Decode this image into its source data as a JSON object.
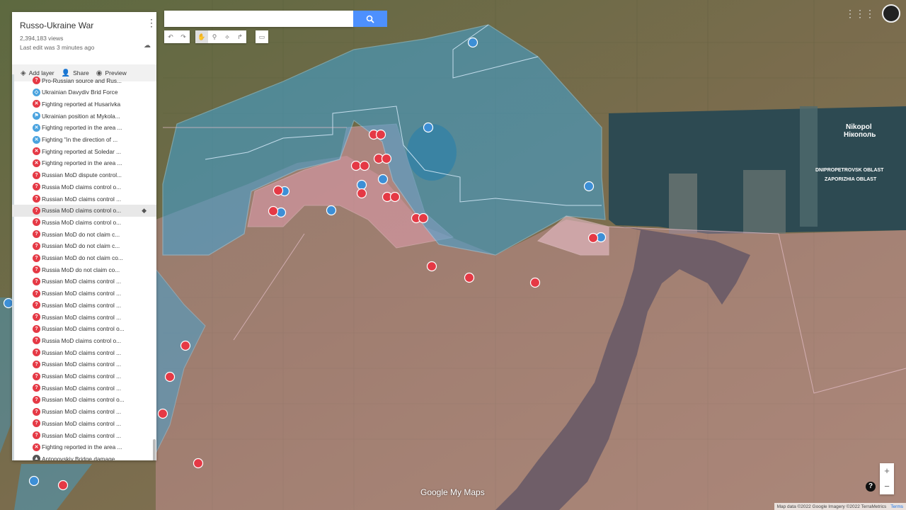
{
  "panel": {
    "title": "Russo-Ukraine War",
    "views": "2,394,183 views",
    "last_edit": "Last edit was 3 minutes ago",
    "tools": {
      "add_layer": "Add layer",
      "share": "Share",
      "preview": "Preview"
    }
  },
  "layers": [
    {
      "label": "Pro-Russian source and Rus...",
      "color": "#e53945",
      "icon": "question-pin-icon"
    },
    {
      "label": "Ukrainian Davydiv Brid Force",
      "color": "#4aa3df",
      "icon": "polygon-icon"
    },
    {
      "label": "Fighting reported at Husarivka",
      "color": "#e53945",
      "icon": "crossed-swords-icon"
    },
    {
      "label": "Ukrainian position at Mykola...",
      "color": "#4aa3df",
      "icon": "flag-icon"
    },
    {
      "label": "Fighting reported in the area ...",
      "color": "#4aa3df",
      "icon": "crossed-swords-icon"
    },
    {
      "label": "Fighting \"in the direction of ...",
      "color": "#4aa3df",
      "icon": "crossed-swords-icon"
    },
    {
      "label": "Fighting reported at Soledar ...",
      "color": "#e53945",
      "icon": "crossed-swords-icon"
    },
    {
      "label": "Fighting reported in the area ...",
      "color": "#e53945",
      "icon": "crossed-swords-icon"
    },
    {
      "label": "Russian MoD dispute control...",
      "color": "#e53945",
      "icon": "question-pin-icon"
    },
    {
      "label": "Russia MoD claims control o...",
      "color": "#e53945",
      "icon": "question-pin-icon"
    },
    {
      "label": "Russian MoD claims control ...",
      "color": "#e53945",
      "icon": "question-pin-icon"
    },
    {
      "label": "Russia MoD claims control o...",
      "color": "#e53945",
      "icon": "question-pin-icon"
    },
    {
      "label": "Russia MoD claims control o...",
      "color": "#e53945",
      "icon": "question-pin-icon"
    },
    {
      "label": "Russian MoD do not claim c...",
      "color": "#e53945",
      "icon": "question-pin-icon"
    },
    {
      "label": "Russian MoD do not claim c...",
      "color": "#e53945",
      "icon": "question-pin-icon"
    },
    {
      "label": "Russian MoD do not claim co...",
      "color": "#e53945",
      "icon": "question-pin-icon"
    },
    {
      "label": "Russia MoD do not claim co...",
      "color": "#e53945",
      "icon": "question-pin-icon"
    },
    {
      "label": "Russian MoD claims control ...",
      "color": "#e53945",
      "icon": "question-pin-icon"
    },
    {
      "label": "Russian MoD claims control ...",
      "color": "#e53945",
      "icon": "question-pin-icon"
    },
    {
      "label": "Russian MoD claims control ...",
      "color": "#e53945",
      "icon": "question-pin-icon"
    },
    {
      "label": "Russian MoD claims control ...",
      "color": "#e53945",
      "icon": "question-pin-icon"
    },
    {
      "label": "Russian MoD claims control o...",
      "color": "#e53945",
      "icon": "question-pin-icon"
    },
    {
      "label": "Russia MoD claims control o...",
      "color": "#e53945",
      "icon": "question-pin-icon"
    },
    {
      "label": "Russian MoD claims control ...",
      "color": "#e53945",
      "icon": "question-pin-icon"
    },
    {
      "label": "Russian MoD claims control ...",
      "color": "#e53945",
      "icon": "question-pin-icon"
    },
    {
      "label": "Russian MoD claims control ...",
      "color": "#e53945",
      "icon": "question-pin-icon"
    },
    {
      "label": "Russian MoD claims control ...",
      "color": "#e53945",
      "icon": "question-pin-icon"
    },
    {
      "label": "Russian MoD claims control o...",
      "color": "#e53945",
      "icon": "question-pin-icon"
    },
    {
      "label": "Russian MoD claims control ...",
      "color": "#e53945",
      "icon": "question-pin-icon"
    },
    {
      "label": "Russian MoD claims control ...",
      "color": "#e53945",
      "icon": "question-pin-icon"
    },
    {
      "label": "Russian MoD claims control ...",
      "color": "#e53945",
      "icon": "question-pin-icon"
    },
    {
      "label": "Fighting reported in the area ...",
      "color": "#e53945",
      "icon": "crossed-swords-icon"
    },
    {
      "label": "Antonovskiy Bridge damage...",
      "color": "#555555",
      "icon": "triangle-icon"
    }
  ],
  "map": {
    "labels": {
      "nikopol": "Nikopol",
      "nikopol_uk": "Нікополь",
      "dnipro_oblast": "DNIPROPETROVSK OBLAST",
      "zaporizhia_oblast": "ZAPORIZHIA OBLAST"
    },
    "colors": {
      "ukraine_zone": "#3fa3d6",
      "russia_zone": "#e8a0b4",
      "marker_red": "#e53945",
      "marker_blue": "#3d8fd6"
    },
    "footer": {
      "map_data": "Map data ©2022 Google Imagery ©2022 TerraMetrics",
      "terms": "Terms"
    },
    "logo": "Google My Maps"
  }
}
